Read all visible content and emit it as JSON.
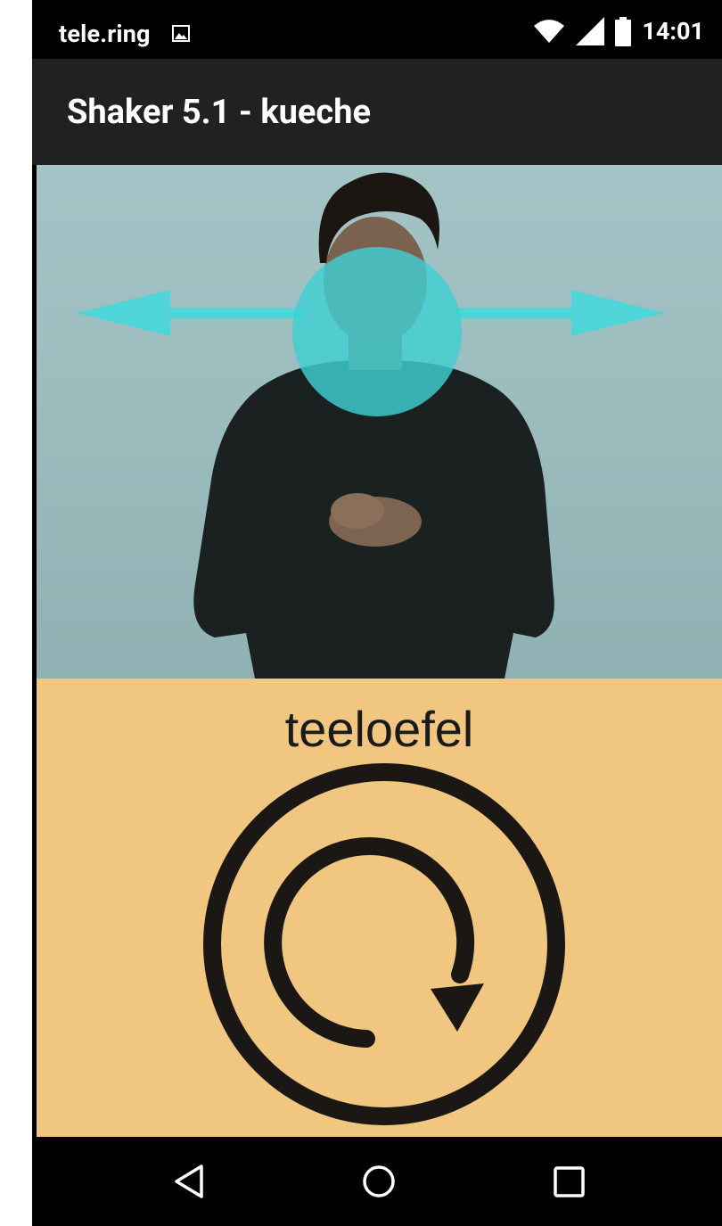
{
  "status_bar": {
    "carrier": "tele.ring",
    "time": "14:01",
    "icons": [
      "image-notification-icon",
      "wifi-icon",
      "cell-signal-icon",
      "battery-icon"
    ]
  },
  "action_bar": {
    "title": "Shaker 5.1 - kueche"
  },
  "video": {
    "icons": [
      "move-left-arrow-icon",
      "move-right-arrow-icon",
      "target-circle-icon"
    ],
    "accent_color": "#4fd4d8"
  },
  "card": {
    "word": "teeloefel",
    "background": "#f0c680",
    "icon": "rotate-clockwise-icon"
  },
  "nav_bar": {
    "buttons": [
      "back-icon",
      "home-icon",
      "recents-icon"
    ]
  }
}
